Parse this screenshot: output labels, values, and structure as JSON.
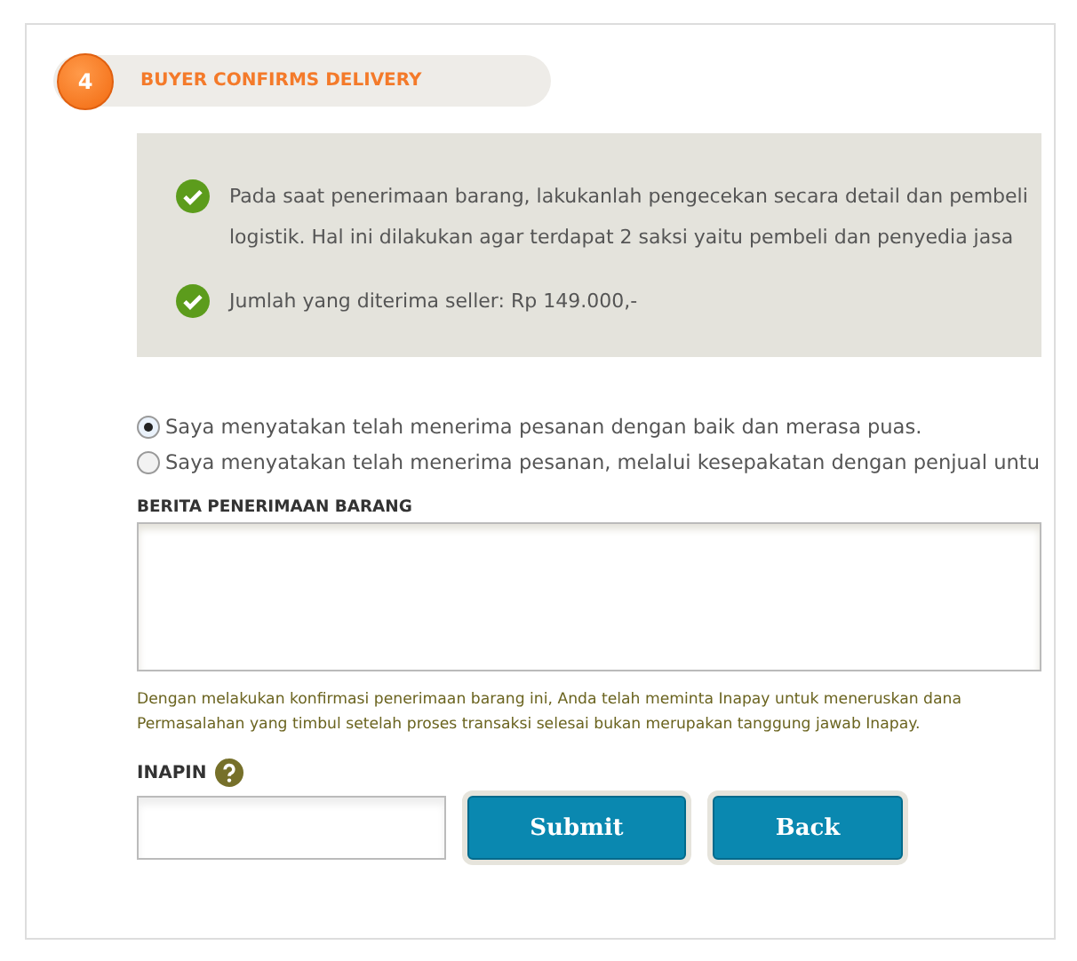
{
  "step": {
    "number": "4",
    "title": "BUYER CONFIRMS DELIVERY"
  },
  "info": [
    "Pada saat penerimaan barang, lakukanlah pengecekan secara detail dan pembeli\nlogistik. Hal ini dilakukan agar terdapat 2 saksi yaitu pembeli dan penyedia jasa",
    "Jumlah yang diterima seller: Rp 149.000,-"
  ],
  "options": [
    {
      "label": "Saya menyatakan telah menerima pesanan dengan baik dan merasa puas.",
      "selected": true
    },
    {
      "label": "Saya menyatakan telah menerima pesanan, melalui kesepakatan dengan penjual untu",
      "selected": false
    }
  ],
  "message_label": "BERITA PENERIMAAN BARANG",
  "note": "Dengan melakukan konfirmasi penerimaan barang ini, Anda telah meminta Inapay untuk meneruskan dana\nPermasalahan yang timbul setelah proses transaksi selesai bukan merupakan tanggung jawab Inapay.",
  "pin_label": "INAPIN",
  "buttons": [
    "Submit",
    "Back"
  ]
}
